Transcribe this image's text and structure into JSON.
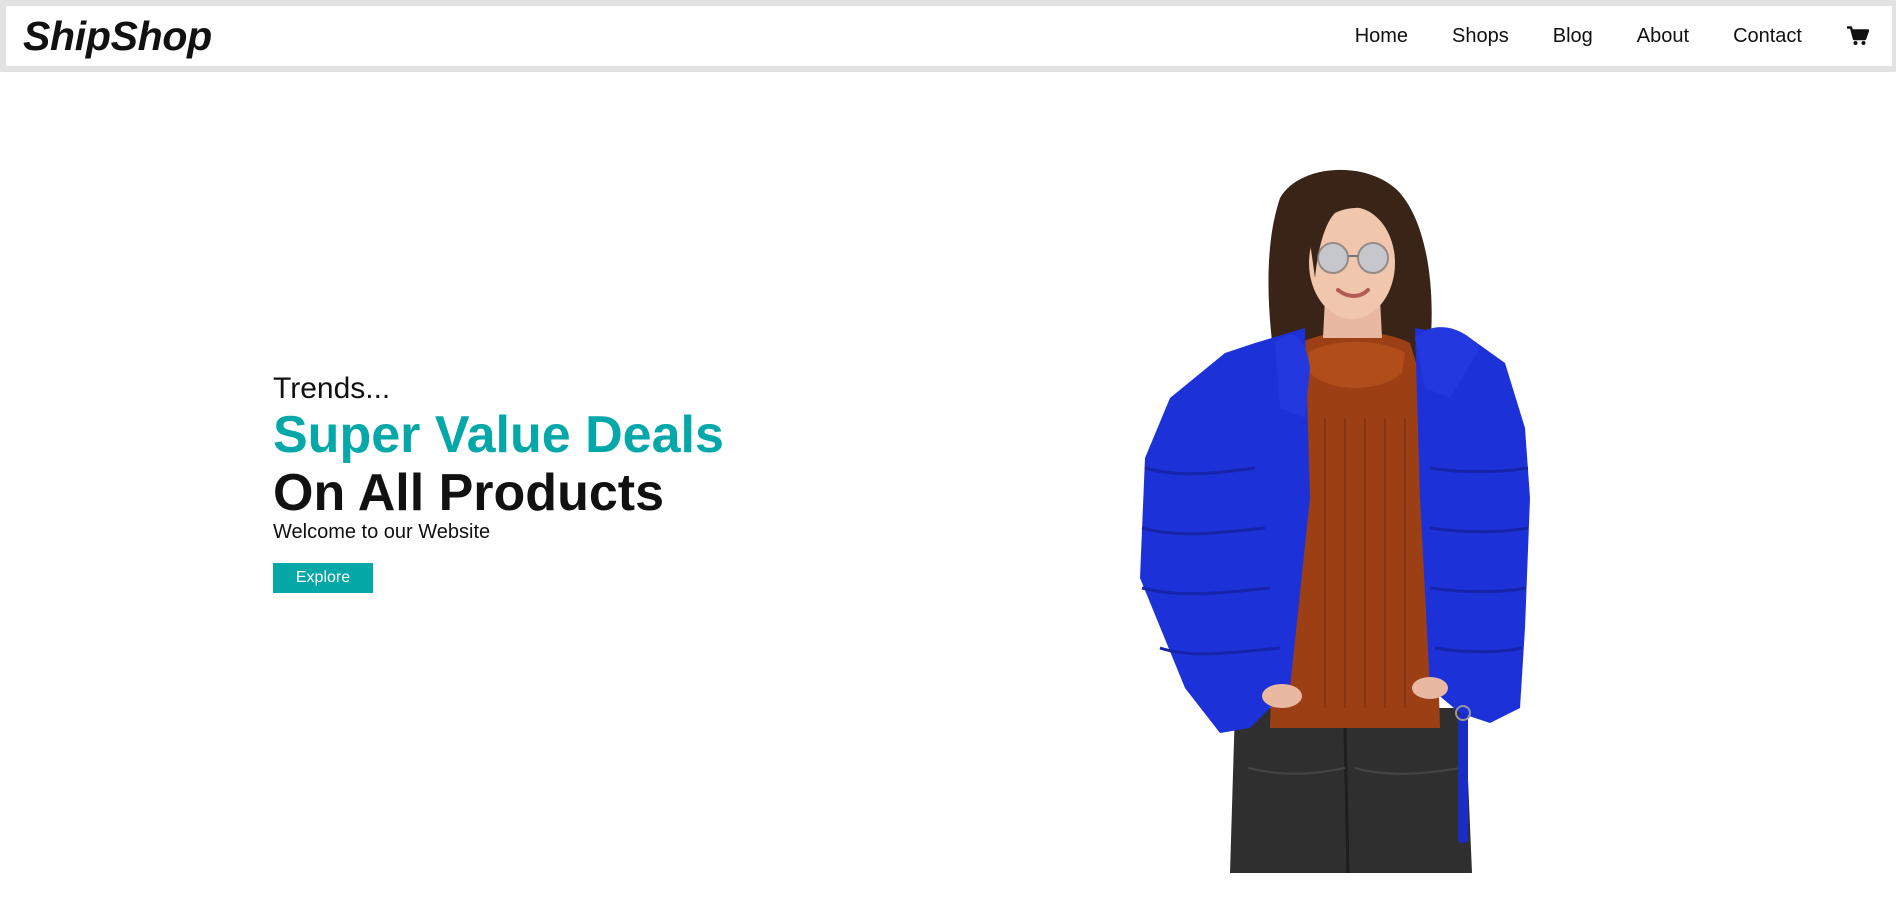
{
  "brand": {
    "logo": "ShipShop"
  },
  "nav": {
    "items": [
      {
        "label": "Home"
      },
      {
        "label": "Shops"
      },
      {
        "label": "Blog"
      },
      {
        "label": "About"
      },
      {
        "label": "Contact"
      }
    ],
    "cart_icon": "shopping-cart-icon"
  },
  "hero": {
    "tagline": "Trends...",
    "headline": "Super Value Deals",
    "subheadline": "On All Products",
    "welcome": "Welcome to our Website",
    "button_label": "Explore",
    "image_alt": "woman wearing blue puffer jacket and brown knit sweater"
  },
  "colors": {
    "accent": "#06a8a7",
    "header_frame": "#e2e2e2",
    "jacket": "#1d31d8",
    "sweater": "#9c3f14",
    "jeans": "#2f2f2f"
  }
}
